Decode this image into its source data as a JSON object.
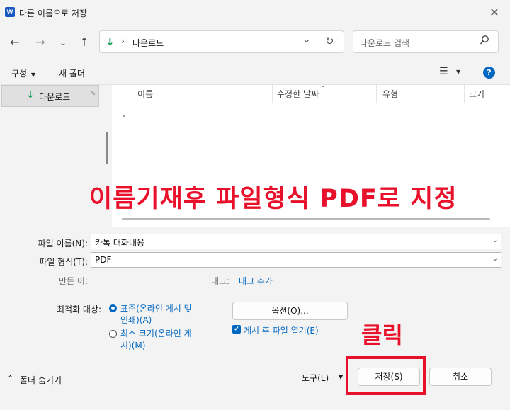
{
  "window": {
    "title": "다른 이름으로 저장",
    "app_icon": "W"
  },
  "nav": {
    "location": "다운로드",
    "search_placeholder": "다운로드 검색"
  },
  "toolbar": {
    "organize": "구성",
    "new_folder": "새 폴더"
  },
  "sidebar": {
    "items": [
      {
        "label": "다운로드",
        "selected": true
      }
    ]
  },
  "columns": [
    "이름",
    "수정한 날짜",
    "유형",
    "크기"
  ],
  "form": {
    "filename_label": "파일 이름(N):",
    "filename_value": "카톡 대화내용",
    "filetype_label": "파일 형식(T):",
    "filetype_value": "PDF",
    "author_label": "만든 이:",
    "tags_label": "태그:",
    "tags_link": "태그 추가",
    "optimize_label": "최적화 대상:",
    "optimize_standard": "표준(온라인 게시 및",
    "optimize_standard_2": "인쇄)(A)",
    "optimize_min": "최소 크기(온라인 게",
    "optimize_min_2": "시)(M)",
    "options_button": "옵션(O)...",
    "open_after": "게시 후 파일 열기(E)",
    "open_after_checked": true
  },
  "footer": {
    "hide_folders": "폴더 숨기기",
    "tools": "도구(L)",
    "save": "저장(S)",
    "cancel": "취소"
  },
  "annotations": {
    "main": "이름기재후 파일형식 PDF로 지정",
    "click": "클릭"
  },
  "colors": {
    "accent": "#0067c0",
    "annotation": "#e8102a"
  }
}
